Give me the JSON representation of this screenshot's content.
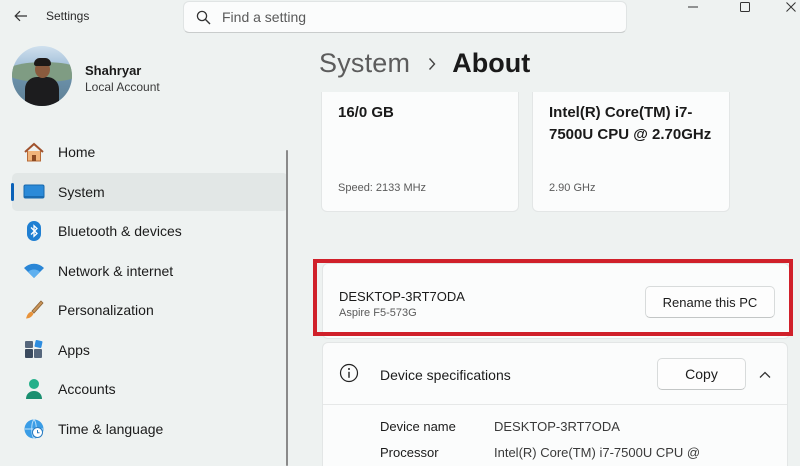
{
  "window": {
    "title": "Settings"
  },
  "search": {
    "placeholder": "Find a setting"
  },
  "profile": {
    "name": "Shahryar",
    "account_type": "Local Account"
  },
  "sidebar": {
    "items": [
      {
        "label": "Home",
        "icon": "home-icon",
        "active": false
      },
      {
        "label": "System",
        "icon": "monitor-icon",
        "active": true
      },
      {
        "label": "Bluetooth & devices",
        "icon": "bluetooth-icon",
        "active": false
      },
      {
        "label": "Network & internet",
        "icon": "wifi-icon",
        "active": false
      },
      {
        "label": "Personalization",
        "icon": "brush-icon",
        "active": false
      },
      {
        "label": "Apps",
        "icon": "apps-icon",
        "active": false
      },
      {
        "label": "Accounts",
        "icon": "person-icon",
        "active": false
      },
      {
        "label": "Time & language",
        "icon": "globe-clock-icon",
        "active": false
      }
    ]
  },
  "breadcrumb": {
    "parent": "System",
    "current": "About"
  },
  "specs": {
    "ram": {
      "value": "16/0 GB",
      "detail": "Speed: 2133 MHz"
    },
    "cpu": {
      "value": "Intel(R) Core(TM) i7-7500U CPU @ 2.70GHz",
      "detail": "2.90 GHz"
    }
  },
  "pc": {
    "name": "DESKTOP-3RT7ODA",
    "model": "Aspire F5-573G",
    "rename_label": "Rename this PC"
  },
  "device_specs": {
    "title": "Device specifications",
    "copy_label": "Copy",
    "rows": [
      {
        "key": "Device name",
        "value": "DESKTOP-3RT7ODA"
      },
      {
        "key": "Processor",
        "value": "Intel(R) Core(TM) i7-7500U CPU @"
      }
    ]
  },
  "colors": {
    "accent": "#0a61b8",
    "highlight": "#d0202a",
    "background": "#eef2f1"
  }
}
